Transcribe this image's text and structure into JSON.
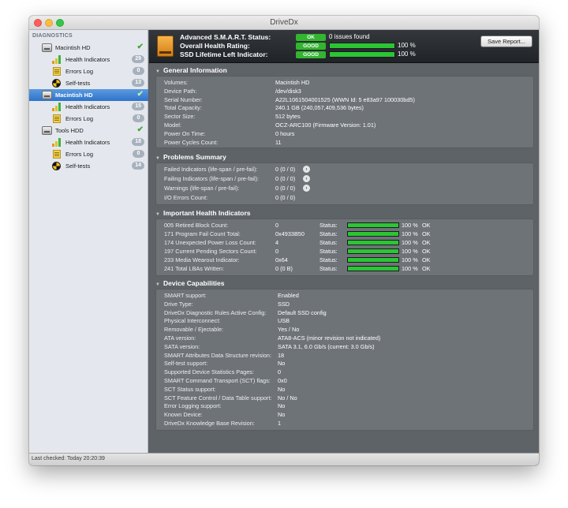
{
  "app": {
    "title": "DriveDx"
  },
  "sidebar": {
    "heading": "DIAGNOSTICS",
    "drives": [
      {
        "name": "Macintish HD",
        "checked": true,
        "selected": false,
        "children": [
          {
            "label": "Health Indicators",
            "count": "29",
            "icon": "bars-icon"
          },
          {
            "label": "Errors Log",
            "count": "0",
            "icon": "log-icon"
          },
          {
            "label": "Self-tests",
            "count": "13",
            "icon": "self-test-icon"
          }
        ]
      },
      {
        "name": "Macintish HD",
        "checked": true,
        "selected": true,
        "children": [
          {
            "label": "Health Indicators",
            "count": "15",
            "icon": "bars-icon"
          },
          {
            "label": "Errors Log",
            "count": "0",
            "icon": "log-icon"
          }
        ]
      },
      {
        "name": "Tools HDD",
        "checked": true,
        "selected": false,
        "children": [
          {
            "label": "Health Indicators",
            "count": "18",
            "icon": "bars-icon"
          },
          {
            "label": "Errors Log",
            "count": "0",
            "icon": "log-icon"
          },
          {
            "label": "Self-tests",
            "count": "14",
            "icon": "self-test-icon"
          }
        ]
      }
    ]
  },
  "status_bar": {
    "text": "Last checked: Today 20:20:39"
  },
  "header": {
    "smart_label": "Advanced S.M.A.R.T. Status:",
    "smart_badge": "OK",
    "smart_text": "0 issues found",
    "health_label": "Overall Health Rating:",
    "health_badge": "GOOD",
    "health_pct": "100 %",
    "health_value": 1.0,
    "ssd_label": "SSD Lifetime Left Indicator:",
    "ssd_badge": "GOOD",
    "ssd_pct": "100 %",
    "ssd_value": 1.0,
    "save_label": "Save Report...",
    "accent_ok": "#33b531",
    "accent_bar": "#2cc534"
  },
  "general": {
    "title": "General Information",
    "rows": [
      {
        "k": "Volumes:",
        "v": "Macintish HD"
      },
      {
        "k": "Device Path:",
        "v": "/dev/disk3"
      },
      {
        "k": "Serial Number:",
        "v": "A22L1061504001525 (WWN Id: 5 e83a97 100030bd5)"
      },
      {
        "k": "Total Capacity:",
        "v": "240.1 GB (240,057,409,536 bytes)"
      },
      {
        "k": "Sector Size:",
        "v": "512 bytes"
      },
      {
        "k": "Model:",
        "v": "OCZ-ARC100  (Firmware Version: 1.01)"
      },
      {
        "k": "Power On Time:",
        "v": "0 hours"
      },
      {
        "k": "Power Cycles Count:",
        "v": "11"
      }
    ]
  },
  "problems": {
    "title": "Problems Summary",
    "rows": [
      {
        "k": "Failed Indicators (life-span / pre-fail):",
        "v": "0  (0 / 0)",
        "arrow": true
      },
      {
        "k": "Failing Indicators (life-span / pre-fail):",
        "v": "0  (0 / 0)",
        "arrow": true
      },
      {
        "k": "Warnings (life-span / pre-fail):",
        "v": "0  (0 / 0)",
        "arrow": true
      },
      {
        "k": "I/O Errors Count:",
        "v": "0  (0 / 0)",
        "arrow": false
      }
    ]
  },
  "health": {
    "title": "Important Health Indicators",
    "status_label": "Status:",
    "rows": [
      {
        "k": "005  Retired Block Count:",
        "v": "0",
        "pct": "100 %",
        "value": 1.0,
        "state": "OK"
      },
      {
        "k": "171  Program Fail Count Total:",
        "v": "0x4933B50",
        "pct": "100 %",
        "value": 1.0,
        "state": "OK"
      },
      {
        "k": "174  Unexpected Power Loss Count:",
        "v": "4",
        "pct": "100 %",
        "value": 1.0,
        "state": "OK"
      },
      {
        "k": "197  Current Pending Sectors Count:",
        "v": "0",
        "pct": "100 %",
        "value": 1.0,
        "state": "OK"
      },
      {
        "k": "233  Media Wearout Indicator:",
        "v": "0x64",
        "pct": "100 %",
        "value": 1.0,
        "state": "OK"
      },
      {
        "k": "241  Total LBAs Written:",
        "v": "0 (0 B)",
        "pct": "100 %",
        "value": 1.0,
        "state": "OK"
      }
    ]
  },
  "capabilities": {
    "title": "Device Capabilities",
    "rows": [
      {
        "k": "SMART support:",
        "v": "Enabled"
      },
      {
        "k": "Drive Type:",
        "v": "SSD"
      },
      {
        "k": "DriveDx Diagnostic Rules Active Config:",
        "v": "Default SSD config"
      },
      {
        "k": "Physical Interconnect:",
        "v": "USB"
      },
      {
        "k": "Removable / Ejectable:",
        "v": "Yes / No"
      },
      {
        "k": "ATA version:",
        "v": "ATA8-ACS (minor revision not indicated)"
      },
      {
        "k": "SATA version:",
        "v": "SATA 3.1, 6.0 Gb/s (current: 3.0 Gb/s)"
      },
      {
        "k": "SMART Attributes Data Structure revision:",
        "v": "18"
      },
      {
        "k": "Self-test support:",
        "v": "No"
      },
      {
        "k": "Supported Device Statistics Pages:",
        "v": "0"
      },
      {
        "k": "SMART Command Transport (SCT) flags:",
        "v": "0x0"
      },
      {
        "k": "SCT Status support:",
        "v": "No"
      },
      {
        "k": "SCT Feature Control / Data Table support:",
        "v": "No / No"
      },
      {
        "k": "Error Logging support:",
        "v": "No"
      },
      {
        "k": "Known Device:",
        "v": "No"
      },
      {
        "k": "DriveDx Knowledge Base Revision:",
        "v": "1"
      }
    ]
  }
}
